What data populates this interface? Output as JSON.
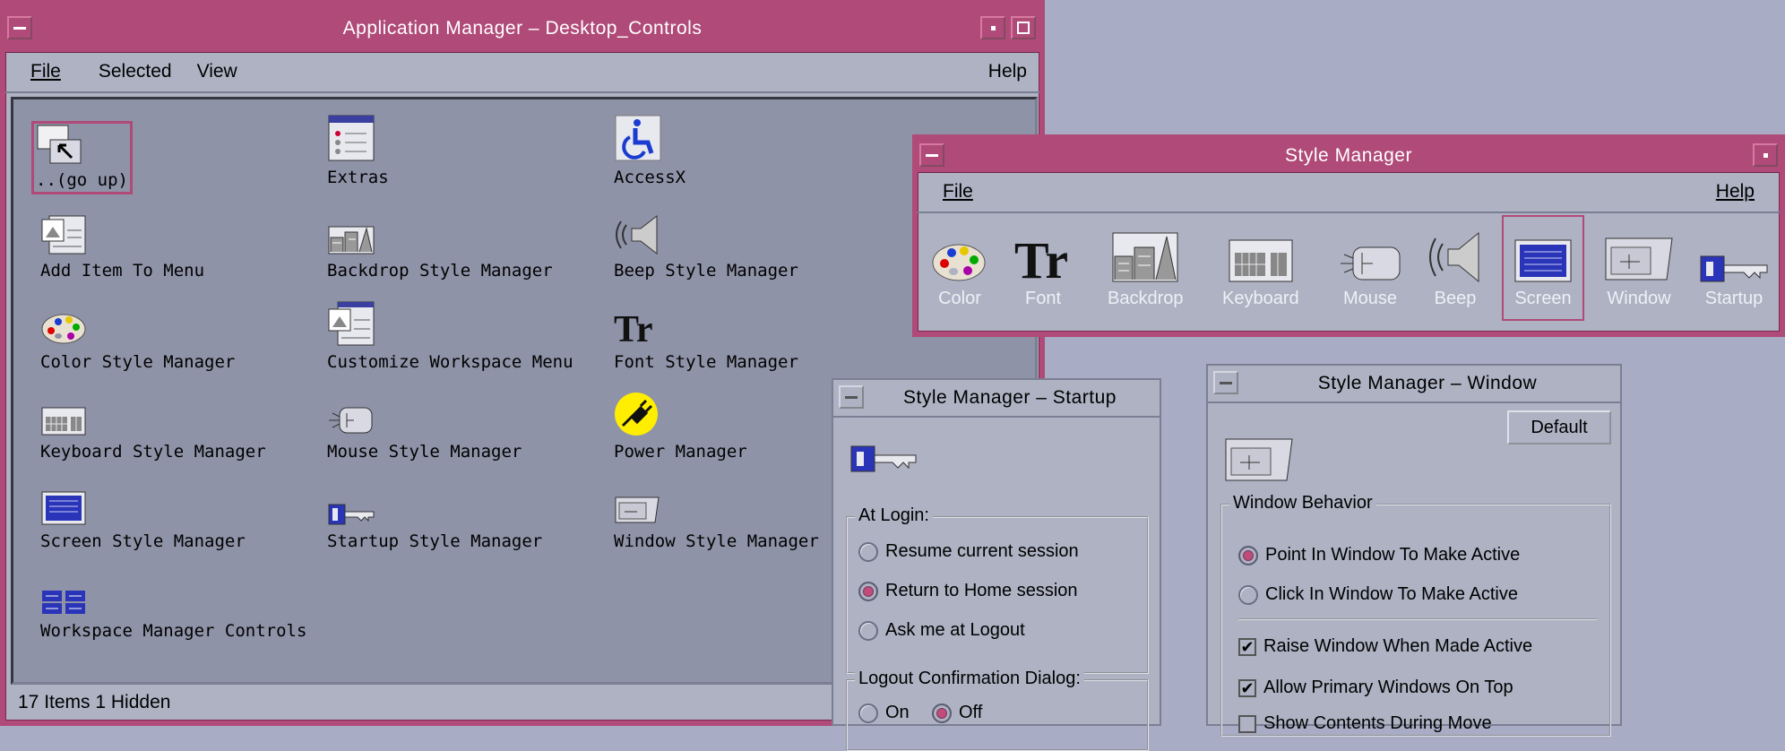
{
  "app_manager": {
    "title": "Application Manager – Desktop_Controls",
    "menu": {
      "file": "File",
      "selected": "Selected",
      "view": "View",
      "help": "Help"
    },
    "items": [
      {
        "label": "..(go up)",
        "icon": "go-up-icon"
      },
      {
        "label": "Extras",
        "icon": "extras-icon"
      },
      {
        "label": "AccessX",
        "icon": "accessibility-icon"
      },
      {
        "label": "Add Item To Menu",
        "icon": "add-item-icon"
      },
      {
        "label": "Backdrop Style Manager",
        "icon": "backdrop-icon"
      },
      {
        "label": "Beep Style Manager",
        "icon": "speaker-icon"
      },
      {
        "label": "Color Style Manager",
        "icon": "palette-icon"
      },
      {
        "label": "Customize Workspace Menu",
        "icon": "customize-menu-icon"
      },
      {
        "label": "Font Style Manager",
        "icon": "font-icon"
      },
      {
        "label": "Keyboard Style Manager",
        "icon": "keyboard-icon"
      },
      {
        "label": "Mouse Style Manager",
        "icon": "mouse-icon"
      },
      {
        "label": "Power Manager",
        "icon": "power-plug-icon"
      },
      {
        "label": "Screen Style Manager",
        "icon": "screen-icon"
      },
      {
        "label": "Startup Style Manager",
        "icon": "key-icon"
      },
      {
        "label": "Window Style Manager",
        "icon": "window-icon"
      },
      {
        "label": "Workspace Manager Controls",
        "icon": "workspace-controls-icon"
      }
    ],
    "status": "17 Items 1 Hidden"
  },
  "style_manager": {
    "title": "Style Manager",
    "menu": {
      "file": "File",
      "help": "Help"
    },
    "tools": [
      {
        "label": "Color",
        "icon": "palette-icon"
      },
      {
        "label": "Font",
        "icon": "font-icon"
      },
      {
        "label": "Backdrop",
        "icon": "backdrop-icon"
      },
      {
        "label": "Keyboard",
        "icon": "keyboard-icon"
      },
      {
        "label": "Mouse",
        "icon": "mouse-icon"
      },
      {
        "label": "Beep",
        "icon": "speaker-icon"
      },
      {
        "label": "Screen",
        "icon": "screen-icon",
        "selected": true
      },
      {
        "label": "Window",
        "icon": "window-icon"
      },
      {
        "label": "Startup",
        "icon": "key-icon"
      }
    ]
  },
  "startup": {
    "title": "Style Manager – Startup",
    "at_login_label": "At Login:",
    "options": [
      "Resume current session",
      "Return to Home session",
      "Ask me at Logout"
    ],
    "selected_option": "Return to Home session",
    "logout_label": "Logout Confirmation Dialog:",
    "on_label": "On",
    "off_label": "Off",
    "logout_selected": "Off"
  },
  "window_style": {
    "title": "Style Manager – Window",
    "default_button": "Default",
    "behavior_label": "Window Behavior",
    "focus_options": [
      "Point In Window To Make Active",
      "Click In Window To Make Active"
    ],
    "focus_selected": "Point In Window To Make Active",
    "checks": [
      {
        "label": "Raise Window When Made Active",
        "checked": true
      },
      {
        "label": "Allow Primary Windows On Top",
        "checked": true
      },
      {
        "label": "Show Contents During Move",
        "checked": false
      }
    ]
  },
  "colors": {
    "accent": "#b04a78",
    "panel": "#aeb2c3",
    "pane": "#8f93a8"
  }
}
